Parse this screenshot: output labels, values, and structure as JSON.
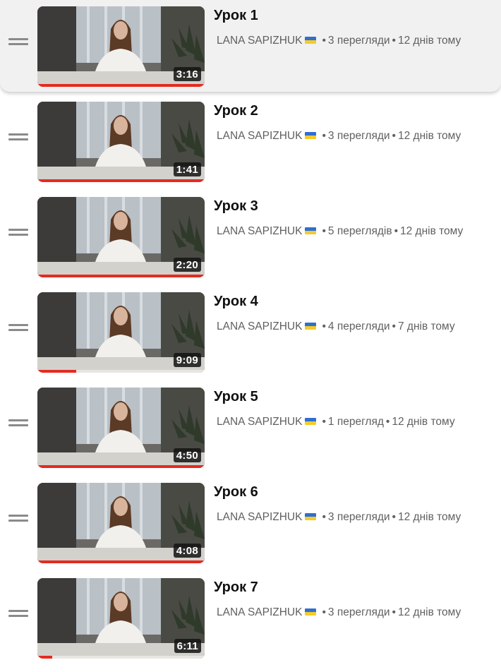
{
  "playlist": {
    "items": [
      {
        "title": "Урок 1",
        "channel": "LANA SAPIZHUK",
        "views": "3 перегляди",
        "age": "12 днів тому",
        "duration": "3:16",
        "progress": 1.0,
        "active": true
      },
      {
        "title": "Урок 2",
        "channel": "LANA SAPIZHUK",
        "views": "3 перегляди",
        "age": "12 днів тому",
        "duration": "1:41",
        "progress": 1.0,
        "active": false
      },
      {
        "title": "Урок 3",
        "channel": "LANA SAPIZHUK",
        "views": "5 переглядів",
        "age": "12 днів тому",
        "duration": "2:20",
        "progress": 1.0,
        "active": false
      },
      {
        "title": "Урок 4",
        "channel": "LANA SAPIZHUK",
        "views": "4 перегляди",
        "age": "7 днів тому",
        "duration": "9:09",
        "progress": 0.23,
        "active": false
      },
      {
        "title": "Урок 5",
        "channel": "LANA SAPIZHUK",
        "views": "1 перегляд",
        "age": "12 днів тому",
        "duration": "4:50",
        "progress": 1.0,
        "active": false
      },
      {
        "title": "Урок 6",
        "channel": "LANA SAPIZHUK",
        "views": "3 перегляди",
        "age": "12 днів тому",
        "duration": "4:08",
        "progress": 1.0,
        "active": false
      },
      {
        "title": "Урок 7",
        "channel": "LANA SAPIZHUK",
        "views": "3 перегляди",
        "age": "12 днів тому",
        "duration": "6:11",
        "progress": 0.09,
        "active": false
      }
    ],
    "separator": "•",
    "icons": {
      "drag": "drag-handle-icon",
      "flag": "ukraine-flag-icon"
    },
    "colors": {
      "progress": "#e52a1f",
      "title": "#111111",
      "meta": "#606060",
      "active_row_bg": "#f1f1f1"
    }
  }
}
